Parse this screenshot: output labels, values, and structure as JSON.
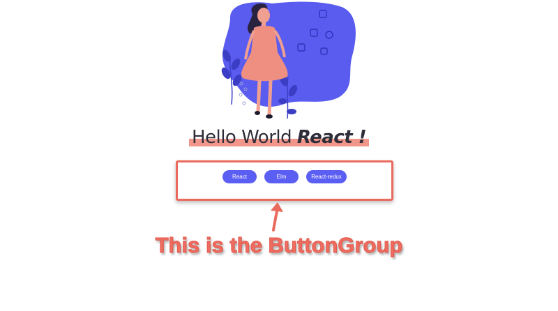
{
  "hero": {
    "title_plain": "Hello World ",
    "title_accent": "React !"
  },
  "button_group": {
    "buttons": [
      {
        "label": "React"
      },
      {
        "label": "Elm"
      },
      {
        "label": "React-redux"
      }
    ]
  },
  "annotation": {
    "caption": "This is the ButtonGroup"
  },
  "colors": {
    "blob": "#5a5cf0",
    "button": "#5b5ef2",
    "highlight": "#ea6a5e",
    "underline": "#f0968a",
    "caption": "#ee6d60"
  }
}
